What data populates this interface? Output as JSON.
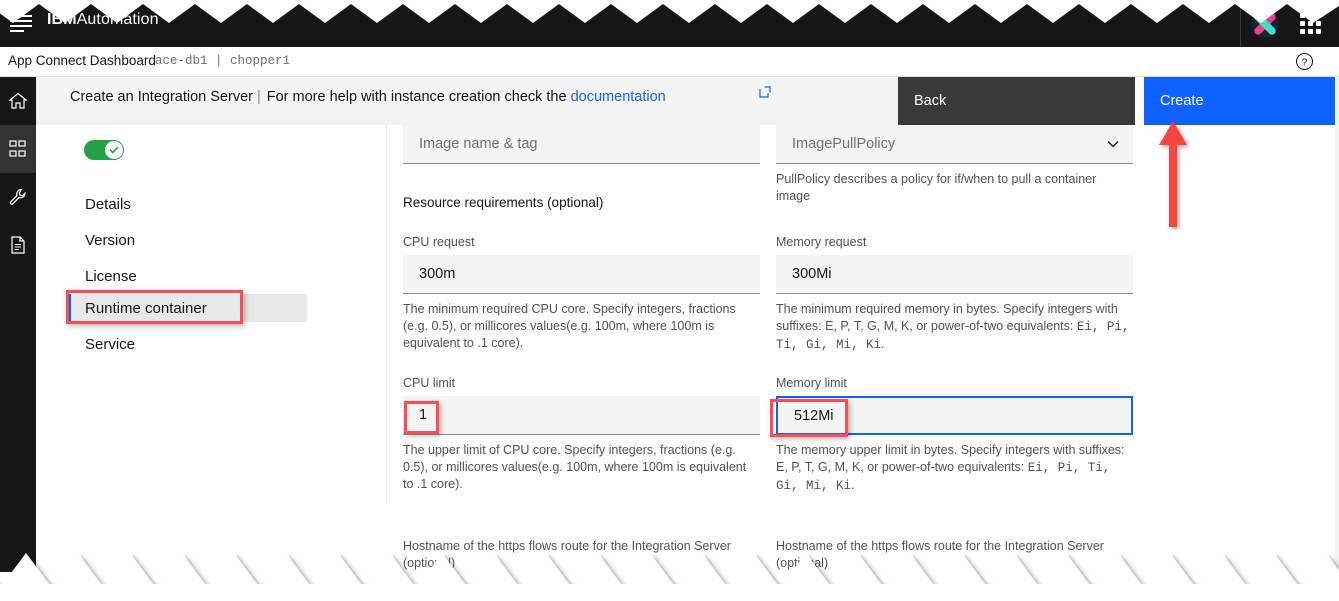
{
  "header": {
    "brand_bold": "IBM",
    "brand_light": "Automation",
    "menu_icon": "hamburger-icon",
    "logo_icon": "ibm-automation-logo",
    "app_switcher_icon": "app-switcher-icon"
  },
  "breadcrumb": {
    "product": "App Connect Dashboard",
    "path": "ace-db1  |  chopper1",
    "help_icon": "help-circle-icon"
  },
  "actionbar": {
    "title": "Create an Integration Server",
    "separator": "|",
    "note": "For more help with instance creation check the",
    "link": "documentation",
    "link_icon": "external-link-icon",
    "back_label": "Back",
    "create_label": "Create",
    "create_color": "#0f62fe",
    "back_color": "#393939"
  },
  "rail": {
    "items": [
      {
        "name": "home-icon",
        "active": false
      },
      {
        "name": "nodes-icon",
        "active": true
      },
      {
        "name": "wrench-icon",
        "active": false
      },
      {
        "name": "document-icon",
        "active": false
      }
    ]
  },
  "sidebar": {
    "toggle": {
      "name": "enabled-toggle",
      "state": "on",
      "color": "#24a148"
    },
    "items": [
      {
        "label": "Details",
        "selected": false
      },
      {
        "label": "Version",
        "selected": false
      },
      {
        "label": "License",
        "selected": false
      },
      {
        "label": "Runtime container",
        "selected": true
      },
      {
        "label": "Service",
        "selected": false
      }
    ]
  },
  "form": {
    "image_name": {
      "label": "",
      "placeholder": "Image name & tag",
      "value": ""
    },
    "pull_policy": {
      "placeholder": "ImagePullPolicy",
      "value": "",
      "helper": "PullPolicy describes a policy for if/when to pull a container image"
    },
    "resource_section": "Resource requirements (optional)",
    "cpu_request": {
      "label": "CPU request",
      "value": "300m",
      "helper": "The minimum required CPU core. Specify integers, fractions (e.g. 0.5), or millicores values(e.g. 100m, where 100m is equivalent to .1 core)."
    },
    "memory_request": {
      "label": "Memory request",
      "helper_a": "The minimum required memory in bytes. Specify integers with suffixes: E, P, T, G, M, K, or power-of-two equivalents: ",
      "helper_code": "Ei, Pi, Ti, Gi, Mi, Ki",
      "helper_b": ".",
      "value": "300Mi"
    },
    "cpu_limit": {
      "label": "CPU limit",
      "value": "1",
      "helper": "The upper limit of CPU core. Specify integers, fractions (e.g. 0.5), or millicores values(e.g. 100m, where 100m is equivalent to .1 core)."
    },
    "memory_limit": {
      "label": "Memory limit",
      "value": "512Mi",
      "focused": true,
      "helper_a": "The memory upper limit in bytes. Specify integers with suffixes: E, P, T, G, M, K, or power-of-two equivalents: ",
      "helper_code": "Ei, Pi, Ti, Gi, Mi, Ki",
      "helper_b": "."
    },
    "hostname_left": "Hostname of the https flows route for the Integration Server (optional)",
    "hostname_right": "Hostname of the https flows route for the Integration Server (optional)"
  },
  "annotations": {
    "highlight_color": "#fa4d56",
    "arrow_color": "#f5453f",
    "boxes": [
      "runtime-container-nav",
      "cpu-limit-value",
      "memory-limit-value"
    ],
    "arrow": "create-button-arrow"
  }
}
